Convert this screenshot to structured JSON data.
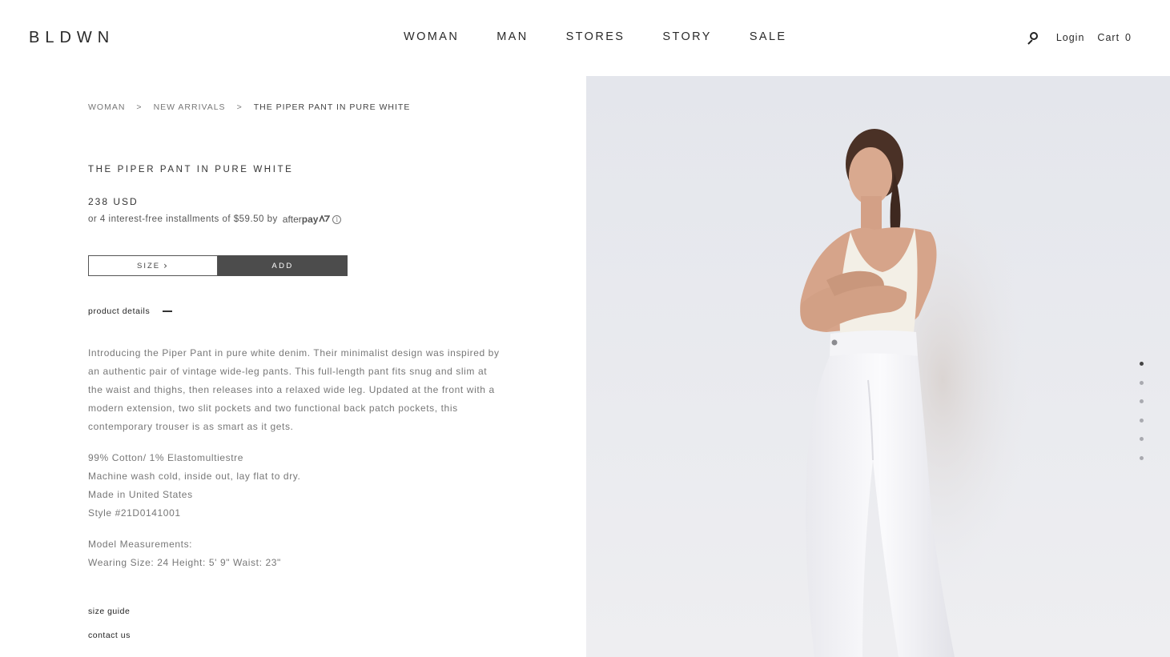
{
  "header": {
    "logo": "BLDWN",
    "nav": [
      "WOMAN",
      "MAN",
      "STORES",
      "STORY",
      "SALE"
    ],
    "login": "Login",
    "cart_label": "Cart",
    "cart_count": "0"
  },
  "breadcrumb": {
    "items": [
      "WOMAN",
      "NEW ARRIVALS",
      "THE PIPER PANT IN PURE WHITE"
    ],
    "separator": ">"
  },
  "product": {
    "title": "THE PIPER PANT IN PURE WHITE",
    "price": "238 USD",
    "installments_text": "or 4 interest-free installments of $59.50 by",
    "afterpay_prefix": "after",
    "afterpay_bold": "pay",
    "size_label": "SIZE",
    "add_label": "ADD",
    "details_label": "product details",
    "description": "Introducing the Piper Pant in pure white denim. Their minimalist design was inspired by an authentic pair of vintage wide-leg pants. This full-length pant fits snug and slim at the waist and thighs, then releases into a relaxed wide leg. Updated at the front with a modern extension, two slit pockets and two functional back patch pockets, this contemporary trouser is as smart as it gets.",
    "specs": [
      "99% Cotton/ 1% Elastomultiestre",
      "Machine wash cold, inside out, lay flat to dry.",
      "Made in United States",
      "Style #21D0141001"
    ],
    "measurements_title": "Model Measurements:",
    "measurements": "Wearing Size: 24 Height: 5' 9\" Waist: 23\""
  },
  "links": {
    "size_guide": "size guide",
    "contact_us": "contact us"
  },
  "gallery": {
    "dot_count": 6,
    "active_index": 0
  },
  "colors": {
    "add_button": "#4c4c4c",
    "background": "#ffffff",
    "hero_bg": "#e6e7ec"
  }
}
